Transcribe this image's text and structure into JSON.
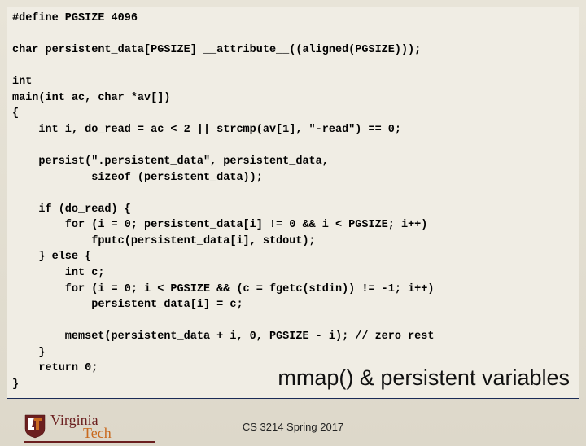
{
  "code": {
    "l1": "#define PGSIZE 4096",
    "l2": "",
    "l3": "char persistent_data[PGSIZE] __attribute__((aligned(PGSIZE)));",
    "l4": "",
    "l5": "int",
    "l6": "main(int ac, char *av[])",
    "l7": "{",
    "l8": "    int i, do_read = ac < 2 || strcmp(av[1], \"-read\") == 0;",
    "l9": "",
    "l10": "    persist(\".persistent_data\", persistent_data,",
    "l11": "            sizeof (persistent_data));",
    "l12": "",
    "l13": "    if (do_read) {",
    "l14": "        for (i = 0; persistent_data[i] != 0 && i < PGSIZE; i++)",
    "l15": "            fputc(persistent_data[i], stdout);",
    "l16": "    } else {",
    "l17": "        int c;",
    "l18": "        for (i = 0; i < PGSIZE && (c = fgetc(stdin)) != -1; i++)",
    "l19": "            persistent_data[i] = c;",
    "l20": "",
    "l21": "        memset(persistent_data + i, 0, PGSIZE - i); // zero rest",
    "l22": "    }",
    "l23": "    return 0;",
    "l24": "}"
  },
  "title": "mmap() & persistent variables",
  "footer": "CS 3214 Spring 2017",
  "logo": {
    "line1": "Virginia",
    "line2": "Tech"
  }
}
